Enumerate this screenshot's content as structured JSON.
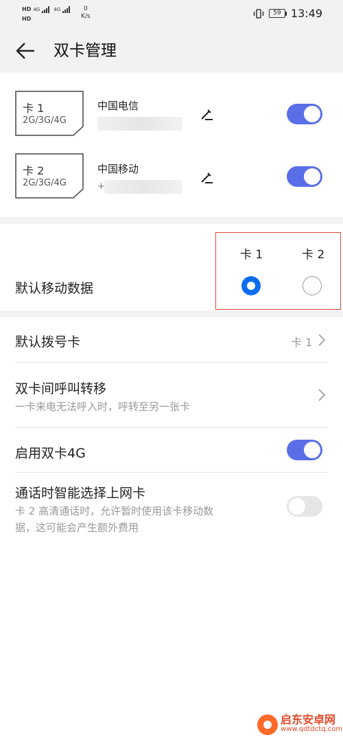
{
  "status_bar": {
    "hd1": "HD",
    "hd2": "HD",
    "net1": "4G",
    "net2": "4G",
    "speed_value": "0",
    "speed_unit": "K/s",
    "battery": "59",
    "time": "13:49"
  },
  "header": {
    "title": "双卡管理"
  },
  "sim_cards": [
    {
      "card_label": "卡 1",
      "networks": "2G/3G/4G",
      "carrier": "中国电信",
      "number_prefix": "",
      "enabled": true
    },
    {
      "card_label": "卡 2",
      "networks": "2G/3G/4G",
      "carrier": "中国移动",
      "number_prefix": "+",
      "enabled": true
    }
  ],
  "default_data": {
    "label": "默认移动数据",
    "col1": "卡 1",
    "col2": "卡 2",
    "selected": "卡 1"
  },
  "settings": {
    "default_dial": {
      "label": "默认拨号卡",
      "value": "卡 1"
    },
    "call_forward": {
      "label": "双卡间呼叫转移",
      "desc": "一卡来电无法呼入时，呼转至另一张卡"
    },
    "dual_4g": {
      "label": "启用双卡4G",
      "enabled": true
    },
    "smart_data": {
      "label": "通话时智能选择上网卡",
      "desc_line1": "卡 2 高清通话时，允许暂时使用该卡移动数",
      "desc_line2": "据，这可能会产生额外费用",
      "enabled": false
    }
  },
  "watermark": {
    "name": "启东安卓网",
    "url": "www.qdtdctq.com"
  },
  "colors": {
    "switch_on": "#5a6ee8",
    "radio_selected": "#0a6cf0",
    "highlight_box": "#e0473a"
  }
}
